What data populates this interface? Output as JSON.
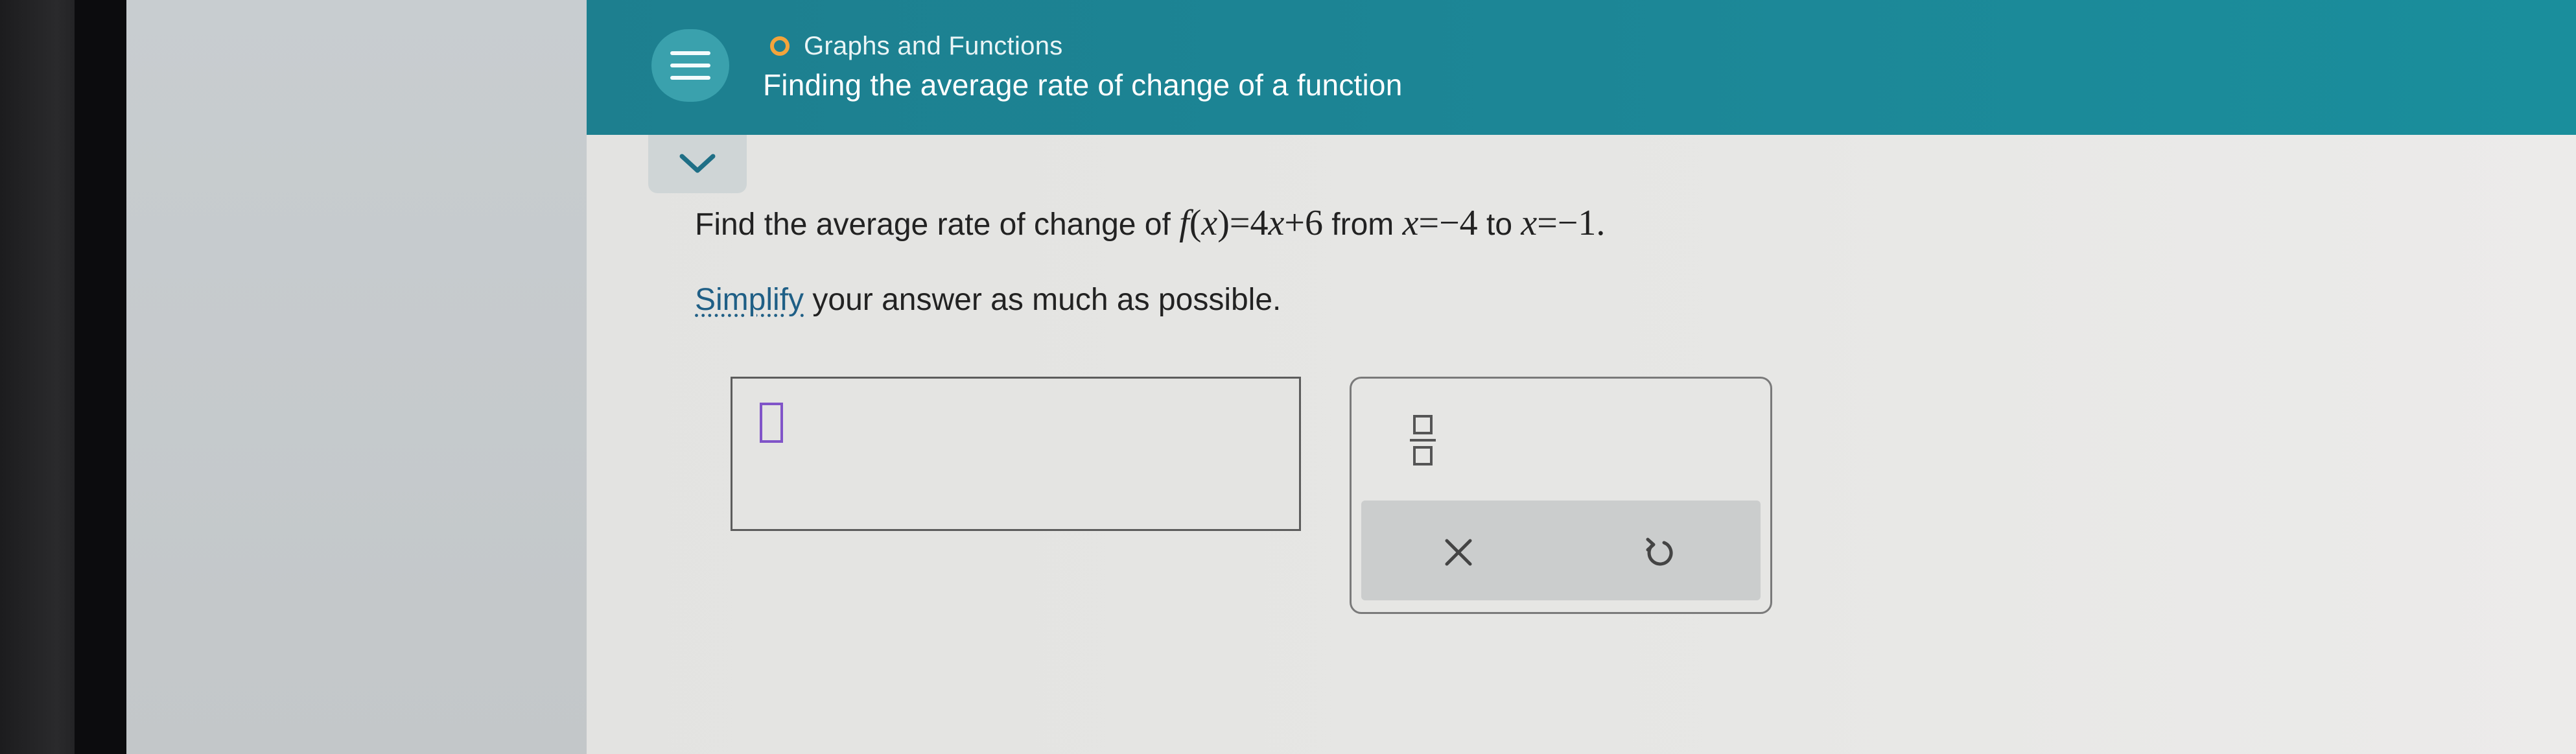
{
  "header": {
    "topic": "Graphs and Functions",
    "title": "Finding the average rate of change of a function",
    "topic_indicator_color": "#f3a43b",
    "background_color": "#1c8797"
  },
  "icons": {
    "menu": "hamburger-menu-icon",
    "collapse": "chevron-down-icon",
    "fraction": "fraction-icon",
    "clear": "close-icon",
    "undo": "undo-icon"
  },
  "question": {
    "prefix": "Find the average rate of change of ",
    "func_f": "f",
    "func_paren_open": "(",
    "func_x": "x",
    "func_paren_close": ")",
    "func_eq": "=4",
    "func_x2": "x",
    "func_rest": "+6",
    "from_word": " from ",
    "var1": "x",
    "val1": "=−4",
    "to_word": " to ",
    "var2": "x",
    "val2": "=−1."
  },
  "instructions": {
    "link": "Simplify",
    "rest": " your answer as much as possible."
  },
  "answer": {
    "value": ""
  }
}
